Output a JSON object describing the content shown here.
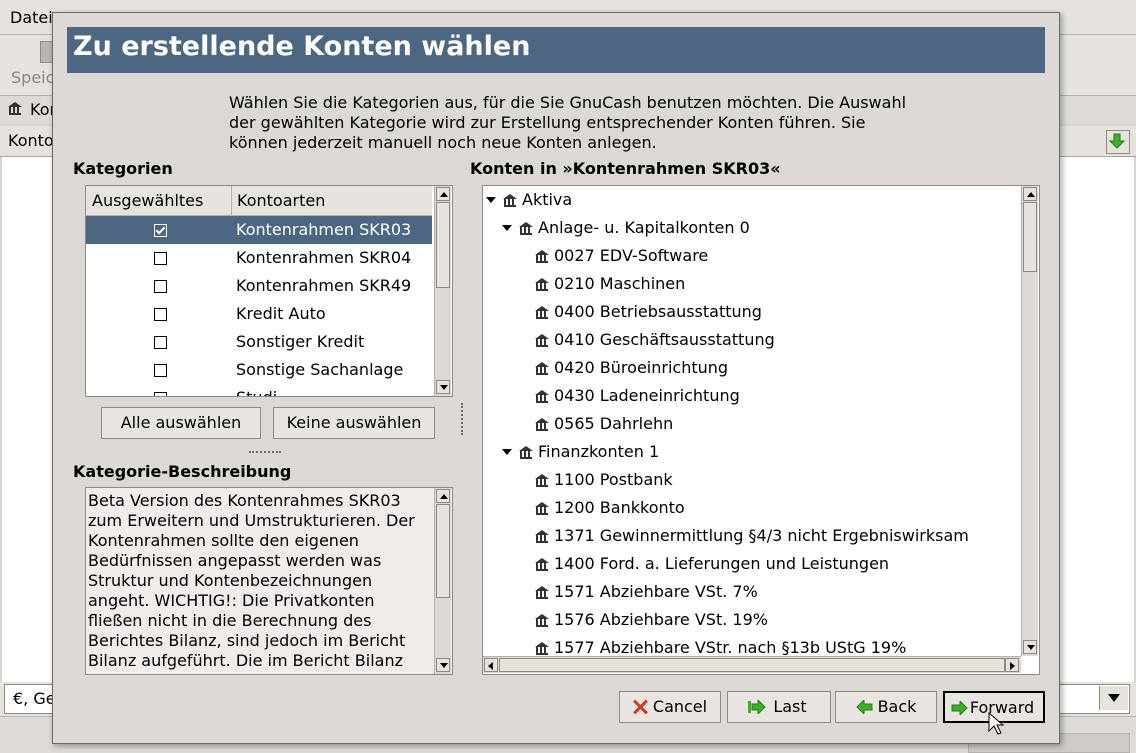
{
  "background": {
    "menu_item": "Datei",
    "toolbar_label": "Speic",
    "tab_label": "Kon",
    "header_label": "Konto",
    "status_combo": "€, Ge"
  },
  "dialog": {
    "title": "Zu erstellende Konten wählen",
    "intro": "Wählen Sie die Kategorien aus, für die Sie GnuCash benutzen möchten. Die Auswahl der gewählten Kategorie wird zur Erstellung entsprechender Konten führen. Sie können jederzeit manuell noch neue Konten anlegen.",
    "categories": {
      "label": "Kategorien",
      "col_selected": "Ausgewähltes",
      "col_types": "Kontoarten",
      "rows": [
        {
          "checked": true,
          "name": "Kontenrahmen SKR03"
        },
        {
          "checked": false,
          "name": "Kontenrahmen SKR04"
        },
        {
          "checked": false,
          "name": "Kontenrahmen SKR49"
        },
        {
          "checked": false,
          "name": "Kredit Auto"
        },
        {
          "checked": false,
          "name": "Sonstiger Kredit"
        },
        {
          "checked": false,
          "name": "Sonstige Sachanlage"
        },
        {
          "checked": false,
          "name": "Studi"
        }
      ],
      "select_all": "Alle auswählen",
      "select_none": "Keine auswählen"
    },
    "description": {
      "label": "Kategorie-Beschreibung",
      "text": "Beta Version des Kontenrahmes SKR03 zum Erweitern und Umstrukturieren. Der Kontenrahmen sollte den eigenen Bedürfnissen angepasst werden was Struktur und Kontenbezeichnungen angeht. WICHTIG!: Die Privatkonten fließen nicht in die Berechnung des Berichtes Bilanz, sind jedoch im Bericht Bilanz aufgeführt. Die im Bericht Bilanz"
    },
    "accounts": {
      "label": "Konten in »Kontenrahmen SKR03«",
      "rows": [
        {
          "level": 0,
          "expandable": true,
          "name": "Aktiva"
        },
        {
          "level": 1,
          "expandable": true,
          "name": "Anlage- u. Kapitalkonten 0"
        },
        {
          "level": 2,
          "expandable": false,
          "name": "0027 EDV-Software"
        },
        {
          "level": 2,
          "expandable": false,
          "name": "0210 Maschinen"
        },
        {
          "level": 2,
          "expandable": false,
          "name": "0400 Betriebsausstattung"
        },
        {
          "level": 2,
          "expandable": false,
          "name": "0410 Geschäftsausstattung"
        },
        {
          "level": 2,
          "expandable": false,
          "name": "0420 Büroeinrichtung"
        },
        {
          "level": 2,
          "expandable": false,
          "name": "0430 Ladeneinrichtung"
        },
        {
          "level": 2,
          "expandable": false,
          "name": "0565 Dahrlehn"
        },
        {
          "level": 1,
          "expandable": true,
          "name": "Finanzkonten 1"
        },
        {
          "level": 2,
          "expandable": false,
          "name": "1100 Postbank"
        },
        {
          "level": 2,
          "expandable": false,
          "name": "1200 Bankkonto"
        },
        {
          "level": 2,
          "expandable": false,
          "name": "1371 Gewinnermittlung §4/3 nicht Ergebniswirksam"
        },
        {
          "level": 2,
          "expandable": false,
          "name": "1400 Ford. a. Lieferungen und Leistungen"
        },
        {
          "level": 2,
          "expandable": false,
          "name": "1571 Abziehbare VSt. 7%"
        },
        {
          "level": 2,
          "expandable": false,
          "name": "1576 Abziehbare VSt. 19%"
        },
        {
          "level": 2,
          "expandable": false,
          "name": "1577 Abziehbare VStr. nach §13b UStG 19%"
        }
      ]
    },
    "buttons": {
      "cancel": "Cancel",
      "last": "Last",
      "back": "Back",
      "forward": "Forward"
    }
  }
}
